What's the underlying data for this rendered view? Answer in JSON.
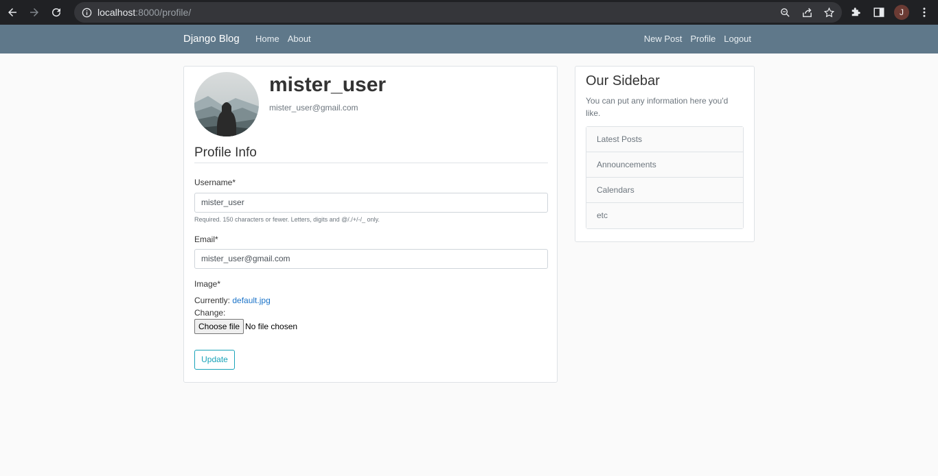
{
  "browser": {
    "url_host": "localhost",
    "url_rest": ":8000/profile/",
    "profile_initial": "J"
  },
  "nav": {
    "brand": "Django Blog",
    "left": [
      "Home",
      "About"
    ],
    "right": [
      "New Post",
      "Profile",
      "Logout"
    ]
  },
  "profile": {
    "username": "mister_user",
    "email": "mister_user@gmail.com",
    "section_title": "Profile Info",
    "username_label": "Username*",
    "username_value": "mister_user",
    "username_help": "Required. 150 characters or fewer. Letters, digits and @/./+/-/_ only.",
    "email_label": "Email*",
    "email_value": "mister_user@gmail.com",
    "image_label": "Image*",
    "currently_label": "Currently:",
    "current_file": "default.jpg",
    "change_label": "Change:",
    "choose_file_label": "Choose file",
    "file_status": "No file chosen",
    "update_label": "Update"
  },
  "sidebar": {
    "title": "Our Sidebar",
    "text": "You can put any information here you'd like.",
    "items": [
      "Latest Posts",
      "Announcements",
      "Calendars",
      "etc"
    ]
  },
  "colors": {
    "navbar": "#5f788a",
    "accent": "#17a2b8",
    "link": "#1a73c8"
  }
}
